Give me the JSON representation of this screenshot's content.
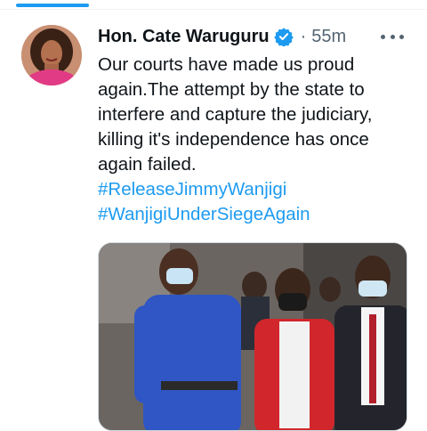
{
  "tweet": {
    "author_name": "Hon. Cate Waruguru",
    "separator": "·",
    "timestamp": "55m",
    "text": "Our courts have made us proud\nagain.The attempt by the state to\ninterfere and capture the judiciary,\nkilling it's independence has once\nagain failed.",
    "hashtags": [
      "#ReleaseJimmyWanjigi",
      "#WanjigiUnderSiegeAgain"
    ]
  },
  "icons": {
    "verified": "verified-badge-icon",
    "more": "more-options-icon"
  },
  "colors": {
    "accent": "#1d9bf0",
    "text": "#0f1419",
    "secondary": "#536471"
  }
}
